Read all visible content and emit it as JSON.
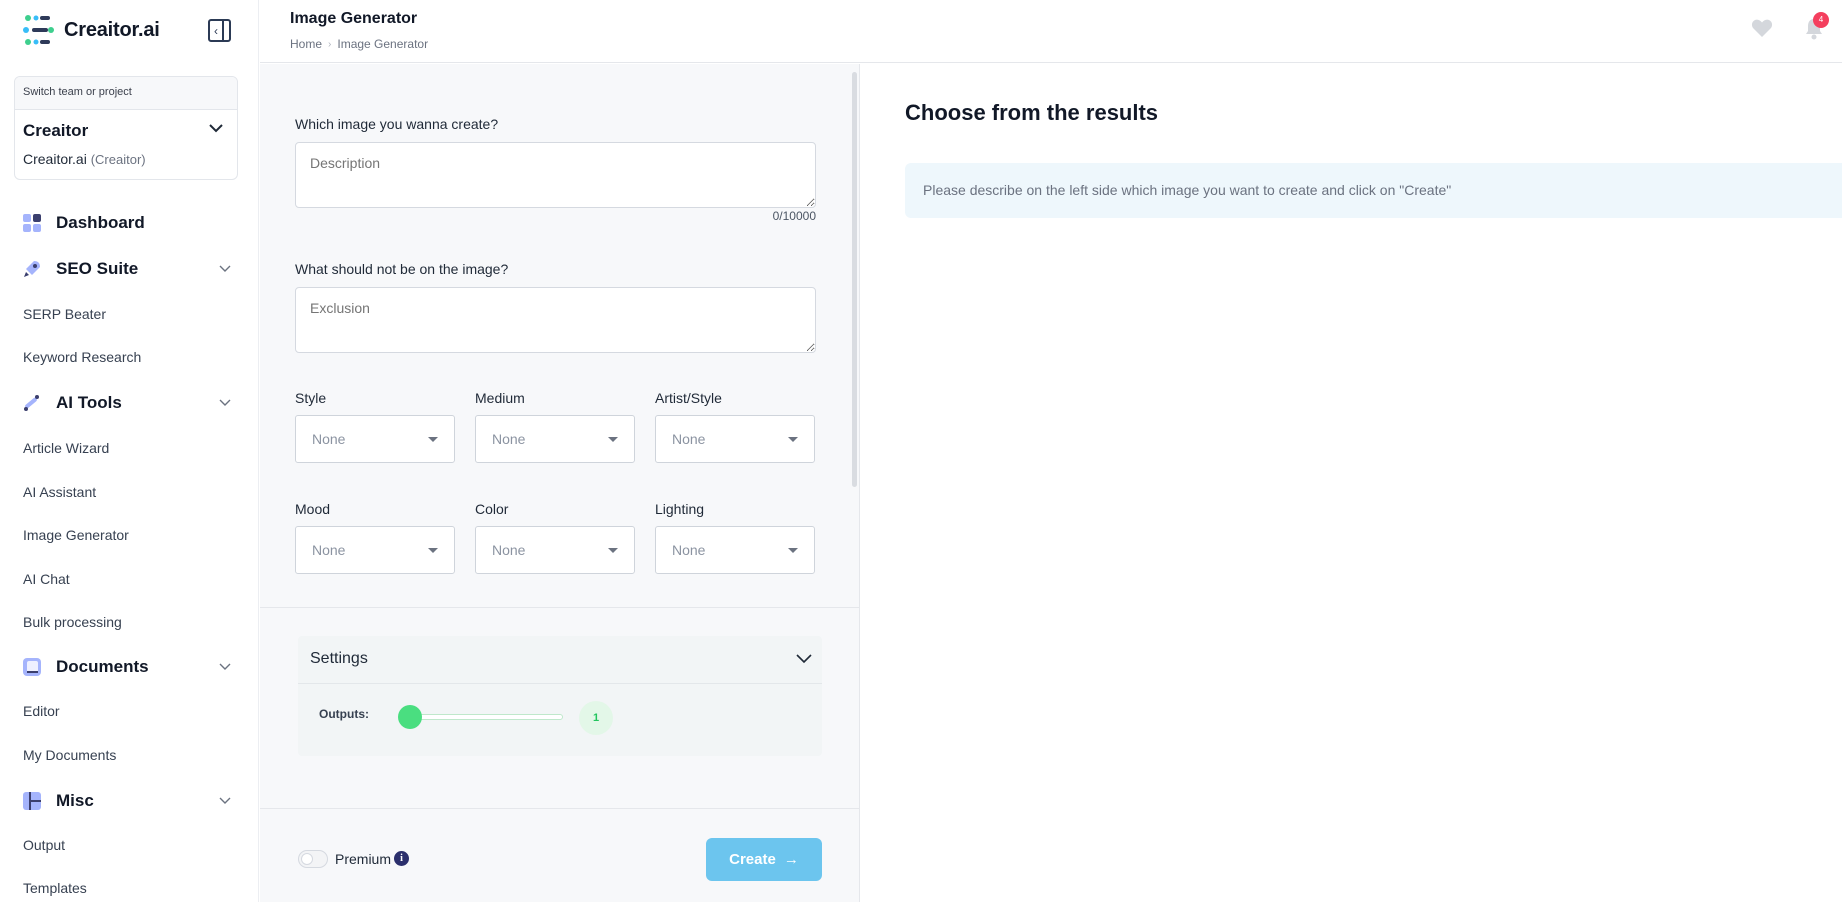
{
  "app": {
    "name": "Creaitor.ai"
  },
  "sidebar": {
    "team_switch": {
      "header": "Switch team or project",
      "team": "Creaitor",
      "project": "Creaitor.ai",
      "project_team": "(Creaitor)"
    },
    "dashboard": "Dashboard",
    "seo_suite": {
      "label": "SEO Suite",
      "items": [
        "SERP Beater",
        "Keyword Research"
      ]
    },
    "ai_tools": {
      "label": "AI Tools",
      "items": [
        "Article Wizard",
        "AI Assistant",
        "Image Generator",
        "AI Chat",
        "Bulk processing"
      ]
    },
    "documents": {
      "label": "Documents",
      "items": [
        "Editor",
        "My Documents"
      ]
    },
    "misc": {
      "label": "Misc",
      "items": [
        "Output",
        "Templates"
      ]
    }
  },
  "header": {
    "title": "Image Generator",
    "breadcrumb": [
      "Home",
      "Image Generator"
    ],
    "notification_count": "4"
  },
  "form": {
    "description_label": "Which image you wanna create?",
    "description_placeholder": "Description",
    "counter": "0/10000",
    "exclusion_label": "What should not be on the image?",
    "exclusion_placeholder": "Exclusion",
    "selects": {
      "style": {
        "label": "Style",
        "value": "None"
      },
      "medium": {
        "label": "Medium",
        "value": "None"
      },
      "artist": {
        "label": "Artist/Style",
        "value": "None"
      },
      "mood": {
        "label": "Mood",
        "value": "None"
      },
      "color": {
        "label": "Color",
        "value": "None"
      },
      "lighting": {
        "label": "Lighting",
        "value": "None"
      }
    },
    "settings": {
      "title": "Settings",
      "outputs_label": "Outputs:",
      "outputs_value": "1"
    },
    "premium_label": "Premium",
    "premium_enabled": false,
    "create_label": "Create"
  },
  "results": {
    "title": "Choose from the results",
    "hint": "Please describe on the left side which image you want to create and click on \"Create\""
  },
  "colors": {
    "accent_green": "#4ade80",
    "create_button": "#6cc5ee",
    "info_bg": "#eef7fc"
  }
}
